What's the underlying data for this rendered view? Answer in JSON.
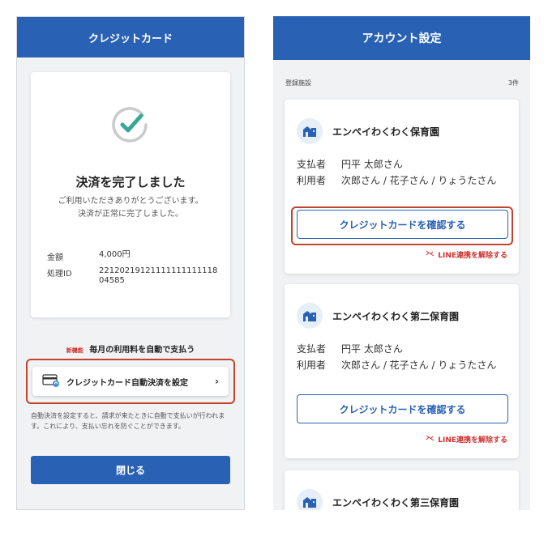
{
  "left": {
    "header_title": "クレジットカード",
    "done_title": "決済を完了しました",
    "done_msg_line1": "ご利用いただきありがとうございます。",
    "done_msg_line2": "決済が正常に完了しました。",
    "amount_label": "金額",
    "amount_value": "4,000円",
    "id_label": "処理ID",
    "id_value": "2212021912111111111111804585",
    "new_badge": "新機能",
    "promo_text": "毎月の利用料を自動で支払う",
    "autopay_label": "クレジットカード自動決済を設定",
    "autopay_chevron": "›",
    "autopay_note": "自動決済を設定すると、請求が来たときに自動で支払いが行われます。これにより、支払い忘れを防ぐことができます。",
    "close_label": "閉じる",
    "check_color": "#3aa795",
    "icons": {
      "check": "check-circle-icon",
      "card": "credit-card-icon",
      "chevron": "chevron-right-icon"
    }
  },
  "right": {
    "header_title": "アカウント設定",
    "registered_label": "登録施設",
    "registered_count": "3件",
    "payer_label": "支払者",
    "user_label": "利用者",
    "facilities": [
      {
        "name": "エンペイわくわく保育園",
        "payer": "円平 太郎さん",
        "users": "次郎さん / 花子さん / りょうたさん",
        "confirm_label": "クレジットカードを確認する",
        "unlink_label": "LINE連携を解除する"
      },
      {
        "name": "エンペイわくわく第二保育園",
        "payer": "円平 太郎さん",
        "users": "次郎さん / 花子さん / りょうたさん",
        "confirm_label": "クレジットカードを確認する",
        "unlink_label": "LINE連携を解除する"
      },
      {
        "name": "エンペイわくわく第三保育園"
      }
    ],
    "icons": {
      "facility": "building-icon",
      "unlink": "link-off-icon"
    }
  },
  "colors": {
    "primary": "#2961b4",
    "highlight": "#c0442e",
    "danger": "#d0312d"
  }
}
